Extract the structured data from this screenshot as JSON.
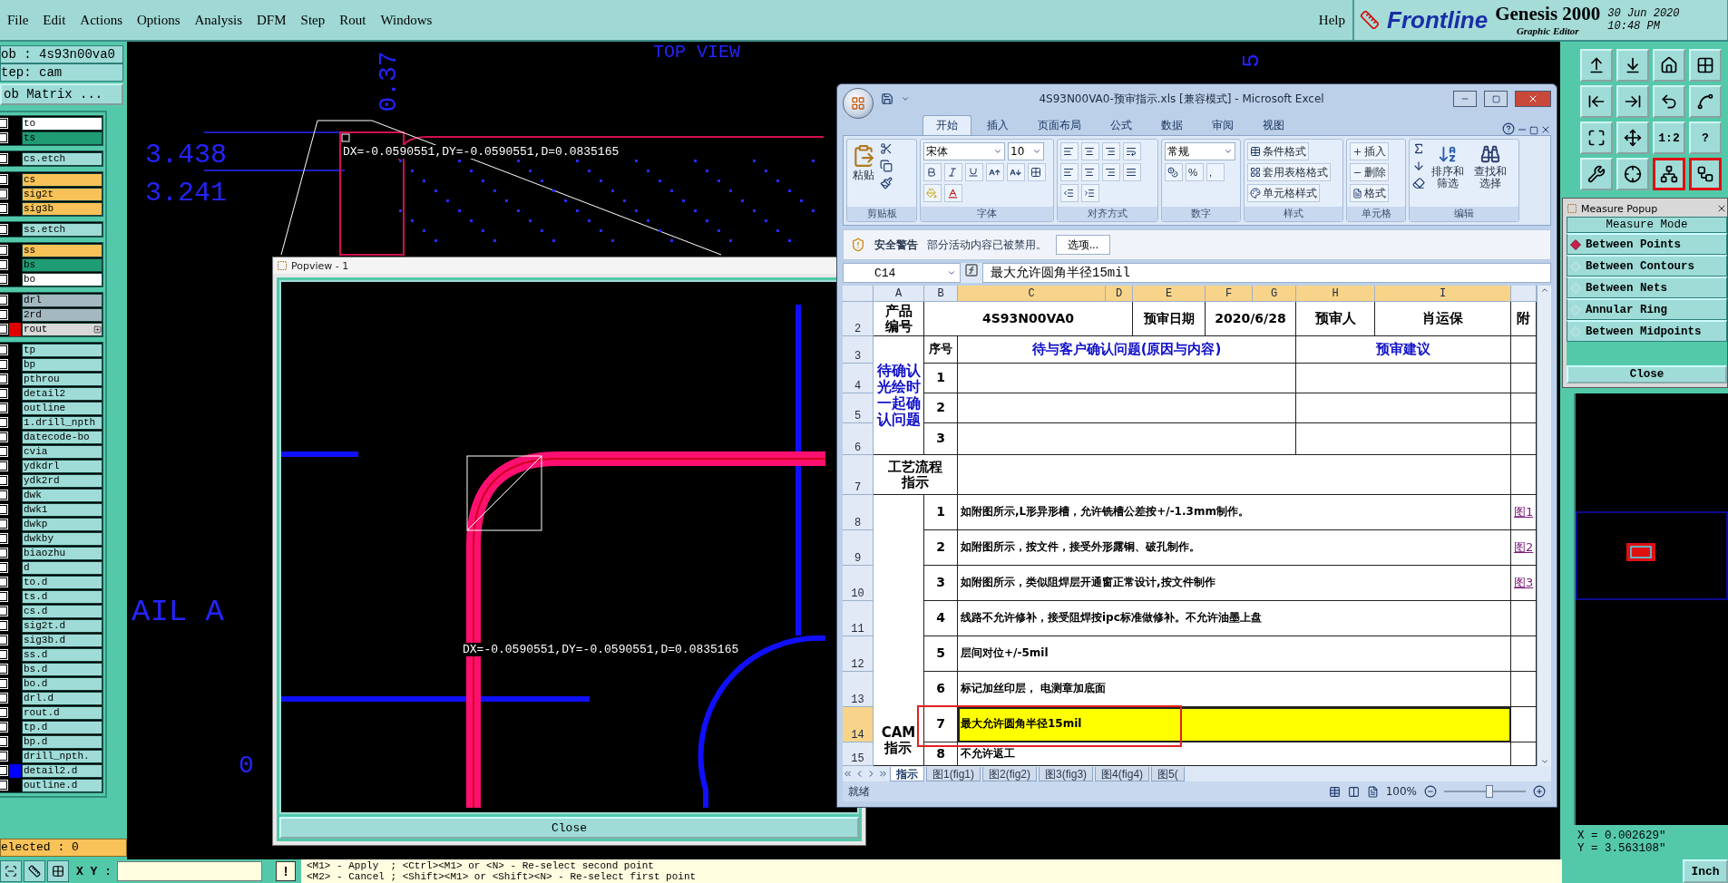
{
  "menu_bar": {
    "items": [
      "File",
      "Edit",
      "Actions",
      "Options",
      "Analysis",
      "DFM",
      "Step",
      "Rout",
      "Windows"
    ],
    "help": "Help"
  },
  "brand": {
    "logo": "Frontline",
    "product": "Genesis 2000",
    "subtitle": "Graphic Editor",
    "date": "30 Jun 2020",
    "time": "10:48 PM"
  },
  "job_panel": {
    "job": "ob : 4s93n00va0",
    "step": "tep: cam",
    "matrix_button": "ob Matrix ...",
    "selected": "elected : 0",
    "layer_groups": [
      [
        {
          "name": "to",
          "color": "#ffffff",
          "checked": false
        },
        {
          "name": "ts",
          "color": "#1f9c74",
          "checked": false
        }
      ],
      [
        {
          "name": "cs.etch",
          "color": "#9fdcd8",
          "checked": false
        }
      ],
      [
        {
          "name": "cs",
          "color": "#f8c258",
          "checked": false
        },
        {
          "name": "sig2t",
          "color": "#f8c258",
          "checked": false
        },
        {
          "name": "sig3b",
          "color": "#f8c258",
          "checked": false
        }
      ],
      [
        {
          "name": "ss.etch",
          "color": "#9fdcd8",
          "checked": false
        }
      ],
      [
        {
          "name": "ss",
          "color": "#f8c258",
          "checked": false
        },
        {
          "name": "bs",
          "color": "#1f9c74",
          "checked": false
        },
        {
          "name": "bo",
          "color": "#ffffff",
          "checked": false
        }
      ],
      [
        {
          "name": "drl",
          "color": "#a4b8c0",
          "checked": false
        },
        {
          "name": "2rd",
          "color": "#a4b8c0",
          "checked": false
        },
        {
          "name": "rout",
          "color": "#d8d8d8",
          "checked": false,
          "marker": {
            "color": "#e00000"
          },
          "expandable": true
        }
      ],
      [
        {
          "name": "tp",
          "color": "#9fdcd8",
          "checked": false
        },
        {
          "name": "bp",
          "color": "#9fdcd8",
          "checked": false
        },
        {
          "name": "pthrou",
          "color": "#9fdcd8",
          "checked": false
        },
        {
          "name": "detail2",
          "color": "#9fdcd8",
          "checked": false
        },
        {
          "name": "outline",
          "color": "#9fdcd8",
          "checked": false
        },
        {
          "name": "1.drill_npth",
          "color": "#9fdcd8",
          "checked": false
        },
        {
          "name": "datecode-bo",
          "color": "#9fdcd8",
          "checked": false
        },
        {
          "name": "cvia",
          "color": "#9fdcd8",
          "checked": false
        },
        {
          "name": "ydkdrl",
          "color": "#9fdcd8",
          "checked": false
        },
        {
          "name": "ydk2rd",
          "color": "#9fdcd8",
          "checked": false
        },
        {
          "name": "dwk",
          "color": "#9fdcd8",
          "checked": false
        },
        {
          "name": "dwk1",
          "color": "#9fdcd8",
          "checked": false
        },
        {
          "name": "dwkp",
          "color": "#9fdcd8",
          "checked": false
        },
        {
          "name": "dwkby",
          "color": "#9fdcd8",
          "checked": false
        },
        {
          "name": "biaozhu",
          "color": "#9fdcd8",
          "checked": false
        },
        {
          "name": "d",
          "color": "#9fdcd8",
          "checked": false
        },
        {
          "name": "to.d",
          "color": "#9fdcd8",
          "checked": false
        },
        {
          "name": "ts.d",
          "color": "#9fdcd8",
          "checked": false
        },
        {
          "name": "cs.d",
          "color": "#9fdcd8",
          "checked": false
        },
        {
          "name": "sig2t.d",
          "color": "#9fdcd8",
          "checked": false
        },
        {
          "name": "sig3b.d",
          "color": "#9fdcd8",
          "checked": false
        },
        {
          "name": "ss.d",
          "color": "#9fdcd8",
          "checked": false
        },
        {
          "name": "bs.d",
          "color": "#9fdcd8",
          "checked": false
        },
        {
          "name": "bo.d",
          "color": "#9fdcd8",
          "checked": false
        },
        {
          "name": "drl.d",
          "color": "#9fdcd8",
          "checked": false
        },
        {
          "name": "rout.d",
          "color": "#9fdcd8",
          "checked": false
        },
        {
          "name": "tp.d",
          "color": "#9fdcd8",
          "checked": false
        },
        {
          "name": "bp.d",
          "color": "#9fdcd8",
          "checked": false
        },
        {
          "name": "drill_npth.",
          "color": "#9fdcd8",
          "checked": false
        },
        {
          "name": "detail2.d",
          "color": "#9fdcd8",
          "checked": false,
          "marker": {
            "color": "#0000ff"
          }
        },
        {
          "name": "outline.d",
          "color": "#9fdcd8",
          "checked": false
        }
      ]
    ]
  },
  "canvas": {
    "labels": [
      "3.438",
      "3.241",
      "0.37",
      "TOP VIEW",
      "5",
      "AIL A",
      "0"
    ],
    "measure": "DX=-0.0590551,DY=-0.0590551,D=0.0835165"
  },
  "popview": {
    "title": "Popview - 1",
    "measure": "DX=-0.0590551,DY=-0.0590551,D=0.0835165",
    "close": "Close"
  },
  "excel": {
    "title": "4S93N00VA0-预审指示.xls  [兼容模式] - Microsoft Excel",
    "tabs": [
      {
        "label": "开始",
        "selected": true
      },
      {
        "label": "插入",
        "selected": false
      },
      {
        "label": "页面布局",
        "selected": false
      },
      {
        "label": "公式",
        "selected": false
      },
      {
        "label": "数据",
        "selected": false
      },
      {
        "label": "审阅",
        "selected": false
      },
      {
        "label": "视图",
        "selected": false
      }
    ],
    "ribbon": {
      "paste": "粘贴",
      "font": "宋体",
      "size": "10",
      "number_format": "常规",
      "percent": "%",
      "comma": ",",
      "styles": [
        "条件格式",
        "套用表格格式",
        "单元格样式"
      ],
      "cells": [
        "插入",
        "删除",
        "格式"
      ],
      "sort": "排序和筛选",
      "find": "查找和选择",
      "groups": [
        "剪贴板",
        "字体",
        "对齐方式",
        "数字",
        "样式",
        "单元格",
        "编辑"
      ]
    },
    "security": {
      "title": "安全警告",
      "message": "部分活动内容已被禁用。",
      "button": "选项..."
    },
    "name_box": "C14",
    "formula": "最大允许圆角半径15mil",
    "sheet": {
      "columns": [
        {
          "label": "A",
          "selected": false
        },
        {
          "label": "B",
          "selected": false
        },
        {
          "label": "C",
          "selected": true
        },
        {
          "label": "D",
          "selected": true
        },
        {
          "label": "E",
          "selected": true
        },
        {
          "label": "F",
          "selected": true
        },
        {
          "label": "G",
          "selected": true
        },
        {
          "label": "H",
          "selected": true
        },
        {
          "label": "I",
          "selected": true
        }
      ],
      "row_numbers": [
        {
          "label": "2",
          "selected": false
        },
        {
          "label": "3",
          "selected": false
        },
        {
          "label": "4",
          "selected": false
        },
        {
          "label": "5",
          "selected": false
        },
        {
          "label": "6",
          "selected": false
        },
        {
          "label": "7",
          "selected": false
        },
        {
          "label": "8",
          "selected": false
        },
        {
          "label": "9",
          "selected": false
        },
        {
          "label": "10",
          "selected": false
        },
        {
          "label": "11",
          "selected": false
        },
        {
          "label": "12",
          "selected": false
        },
        {
          "label": "13",
          "selected": false
        },
        {
          "label": "14",
          "selected": true
        },
        {
          "label": "15",
          "selected": false
        }
      ],
      "info_row": {
        "product_label": "产品编号",
        "product": "4S93N00VA0",
        "date_label": "预审日期",
        "date": "2020/6/28",
        "reviewer_label": "预审人",
        "reviewer": "肖运保",
        "attachment_label": "附"
      },
      "question_header": {
        "seq": "序号",
        "question": "待与客户确认问题(原因与内容)",
        "advice": "预审建议"
      },
      "question_group": "待确认光绘时一起确认问题",
      "questions": [
        "1",
        "2",
        "3"
      ],
      "process_label": "工艺流程指示",
      "cam_label": "CAM\n指示",
      "instructions": [
        {
          "no": "1",
          "text": "如附图所示,L形异形槽，允许铣槽公差按+/-1.3mm制作。",
          "link": "图1",
          "selected": false
        },
        {
          "no": "2",
          "text": "如附图所示，按文件，接受外形露铜、破孔制作。",
          "link": "图2",
          "selected": false
        },
        {
          "no": "3",
          "text": "如附图所示，类似阻焊层开通窗正常设计,按文件制作",
          "link": "图3",
          "selected": false
        },
        {
          "no": "4",
          "text": "线路不允许修补，接受阻焊按ipc标准做修补。不允许油墨上盘",
          "selected": false
        },
        {
          "no": "5",
          "text": "层间对位+/-5mil",
          "selected": false
        },
        {
          "no": "6",
          "text": "标记加丝印层， 电测章加底面",
          "selected": false
        },
        {
          "no": "7",
          "text": "最大允许圆角半径15mil",
          "selected": true,
          "color": "#ffff00"
        },
        {
          "no": "8",
          "text": "不允许返工",
          "selected": false
        }
      ]
    },
    "sheet_tabs": [
      {
        "label": "指示",
        "selected": true
      },
      {
        "label": "图1(fig1)",
        "selected": false
      },
      {
        "label": "图2(fig2)",
        "selected": false
      },
      {
        "label": "图3(fig3)",
        "selected": false
      },
      {
        "label": "图4(fig4)",
        "selected": false
      },
      {
        "label": "图5(",
        "selected": false
      }
    ],
    "status": {
      "text": "就绪",
      "zoom": "100%",
      "level": 0.55
    }
  },
  "right_toolbar": [
    {
      "active": false
    },
    {
      "active": false
    },
    {
      "active": false
    },
    {
      "active": false
    },
    {
      "active": false
    },
    {
      "active": false
    },
    {
      "active": false
    },
    {
      "active": false
    },
    {
      "active": false
    },
    {
      "active": false
    },
    {
      "label": "1:2",
      "active": false
    },
    {
      "label": "?",
      "active": false
    },
    {
      "active": false
    },
    {
      "active": false
    },
    {
      "active": true
    },
    {
      "active": true
    }
  ],
  "measure_popup": {
    "title": "Measure Popup",
    "heading": "Measure Mode",
    "options": [
      {
        "label": "Between Points",
        "selected": true
      },
      {
        "label": "Between Contours",
        "selected": false
      },
      {
        "label": "Between Nets",
        "selected": false
      },
      {
        "label": "Annular Ring",
        "selected": false
      },
      {
        "label": "Between Midpoints",
        "selected": false
      }
    ],
    "close": "Close"
  },
  "coordinates": {
    "x": "X = 0.002629\"",
    "y": "Y = 3.563108\""
  },
  "bottom_bar": {
    "xy_label": "X Y :",
    "alert": "!",
    "messages": [
      "<M1> - Apply  ; <Ctrl><M1> or <N> - Re-select second point",
      "<M2> - Cancel ; <Shift><M1> or <Shift><N> - Re-select first point"
    ],
    "units": "Inch"
  }
}
